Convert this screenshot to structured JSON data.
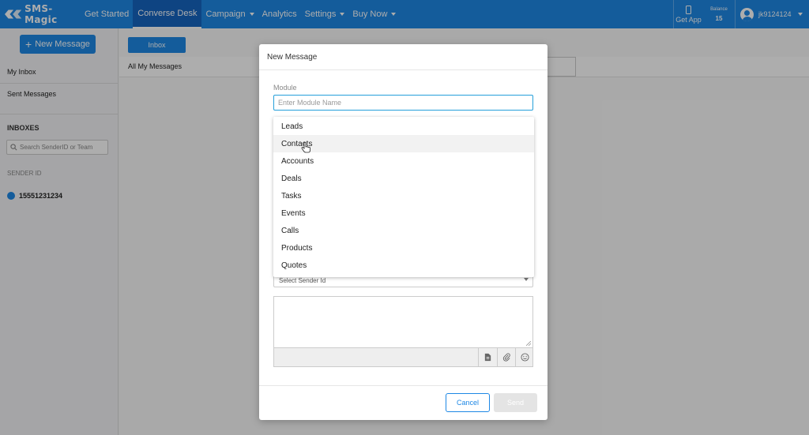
{
  "brand": {
    "name": "SMS-Magic"
  },
  "nav": {
    "items": [
      {
        "label": "Get Started"
      },
      {
        "label": "Converse Desk",
        "active": true
      },
      {
        "label": "Campaign",
        "dropdown": true
      },
      {
        "label": "Analytics"
      },
      {
        "label": "Settings",
        "dropdown": true
      },
      {
        "label": "Buy Now",
        "dropdown": true
      }
    ],
    "get_app": "Get App",
    "balance_label": "Balance",
    "balance_value": "15",
    "user_name": "jk9124124"
  },
  "sidebar": {
    "new_message": "New Message",
    "my_inbox": "My Inbox",
    "sent_messages": "Sent Messages",
    "inboxes_heading": "INBOXES",
    "search_placeholder": "Search SenderID or Team",
    "sender_id_label": "SENDER ID",
    "sender_number": "15551231234"
  },
  "main": {
    "inbox_tab": "Inbox",
    "all_messages": "All My Messages"
  },
  "modal": {
    "title": "New Message",
    "module_label": "Module",
    "module_placeholder": "Enter Module Name",
    "module_options": [
      "Leads",
      "Contacts",
      "Accounts",
      "Deals",
      "Tasks",
      "Events",
      "Calls",
      "Products",
      "Quotes"
    ],
    "hovered_option": "Contacts",
    "sender_placeholder": "Select Sender Id",
    "cancel": "Cancel",
    "send": "Send"
  },
  "colors": {
    "primary": "#1e88e5",
    "primary_dark": "#1565c0",
    "focus_border": "#26a0da",
    "disabled": "#e4e4e4"
  },
  "icons": [
    "sms-magic-logo-icon",
    "phone-icon",
    "user-avatar-icon",
    "plus-icon",
    "search-icon",
    "chat-icon",
    "pointer-cursor-icon",
    "template-icon",
    "attachment-icon",
    "emoji-icon",
    "chevron-down-icon"
  ]
}
